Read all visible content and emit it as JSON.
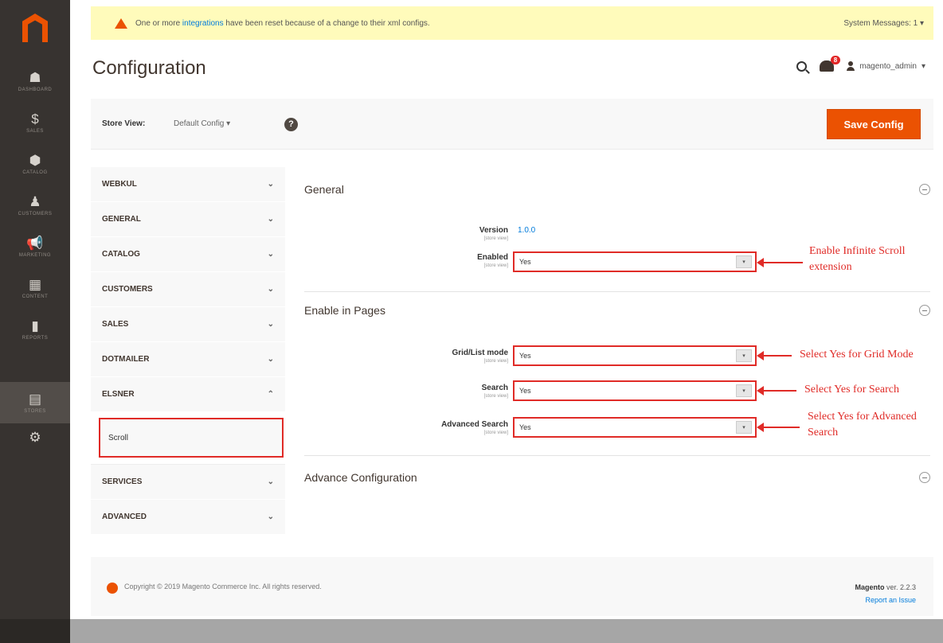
{
  "sidebar": {
    "items": [
      {
        "label": "Dashboard",
        "icon": "dashboard-icon",
        "glyph": "☗"
      },
      {
        "label": "Sales",
        "icon": "sales-icon",
        "glyph": "$"
      },
      {
        "label": "Catalog",
        "icon": "catalog-icon",
        "glyph": "⬢"
      },
      {
        "label": "Customers",
        "icon": "customers-icon",
        "glyph": "♟"
      },
      {
        "label": "Marketing",
        "icon": "marketing-icon",
        "glyph": "📢"
      },
      {
        "label": "Content",
        "icon": "content-icon",
        "glyph": "▦"
      },
      {
        "label": "Reports",
        "icon": "reports-icon",
        "glyph": "▮"
      },
      {
        "label": "Stores",
        "icon": "stores-icon",
        "glyph": "▤"
      },
      {
        "label": "",
        "icon": "system-gear-icon",
        "glyph": "⚙"
      }
    ]
  },
  "system_message": {
    "text_before": "One or more ",
    "link": "integrations",
    "text_after": " have been reset because of a change to their xml configs.",
    "system_messages": "System Messages: 1"
  },
  "header": {
    "title": "Configuration",
    "notification_count": "8",
    "username": "magento_admin"
  },
  "store_view": {
    "label": "Store View:",
    "value": "Default Config",
    "help": "?",
    "save_label": "Save Config"
  },
  "tabs": [
    {
      "label": "WEBKUL",
      "chevron": "⌄"
    },
    {
      "label": "GENERAL",
      "chevron": "⌄"
    },
    {
      "label": "CATALOG",
      "chevron": "⌄"
    },
    {
      "label": "CUSTOMERS",
      "chevron": "⌄"
    },
    {
      "label": "SALES",
      "chevron": "⌄"
    },
    {
      "label": "DOTMAILER",
      "chevron": "⌄"
    },
    {
      "label": "ELSNER",
      "chevron": "⌃"
    },
    {
      "label": "SERVICES",
      "chevron": "⌄"
    },
    {
      "label": "ADVANCED",
      "chevron": "⌄"
    }
  ],
  "sub_item": "Scroll",
  "sections": {
    "general": "General",
    "enable_in_pages": "Enable in Pages",
    "advance": "Advance Configuration"
  },
  "fields": {
    "version_label": "Version",
    "version_value": "1.0.0",
    "scope": "[store view]",
    "enabled_label": "Enabled",
    "enabled_value": "Yes",
    "grid_label": "Grid/List mode",
    "grid_value": "Yes",
    "search_label": "Search",
    "search_value": "Yes",
    "advsearch_label": "Advanced Search",
    "advsearch_value": "Yes",
    "arrow": "▾"
  },
  "annotations": {
    "enable": "Enable Infinite Scroll extension",
    "grid": "Select Yes for Grid Mode",
    "search": "Select Yes for Search",
    "advsearch": "Select Yes for Advanced Search"
  },
  "footer": {
    "copyright": "Copyright © 2019 Magento Commerce Inc. All rights reserved.",
    "brand": "Magento",
    "version": " ver. 2.2.3",
    "report": "Report an Issue"
  }
}
